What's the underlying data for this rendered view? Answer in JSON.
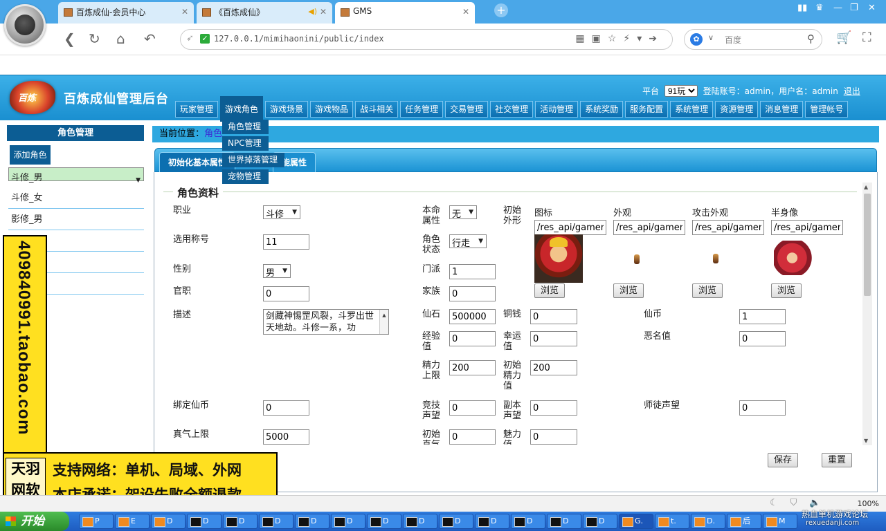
{
  "browser": {
    "tabs": [
      {
        "label": "百炼成仙-会员中心",
        "close": "✕"
      },
      {
        "label": "《百炼成仙》",
        "close": "✕"
      },
      {
        "label": "GMS",
        "close": "✕"
      }
    ],
    "url": "127.0.0.1/mimihaonini/public/index",
    "search_engine": "百度",
    "new_tab": "+",
    "audio_icon": "speaker-icon"
  },
  "app": {
    "title": "百炼成仙管理后台",
    "logo_text": "百炼",
    "platform_label": "平台",
    "platform_value": "91玩",
    "login_text": "登陆账号：admin，用户名：admin",
    "logout": "退出",
    "menu": [
      "玩家管理",
      "游戏角色",
      "游戏场景",
      "游戏物品",
      "战斗相关",
      "任务管理",
      "交易管理",
      "社交管理",
      "活动管理",
      "系统奖励",
      "服务配置",
      "系统管理",
      "资源管理",
      "消息管理",
      "管理帐号"
    ],
    "dropdown": [
      "角色管理",
      "NPC管理",
      "世界掉落管理",
      "宠物管理"
    ]
  },
  "sidebar": {
    "header": "角色管理",
    "add_button": "添加角色",
    "items": [
      "斗修_男",
      "斗修_女",
      "影修_男"
    ]
  },
  "content": {
    "crumb_label": "当前位置：",
    "crumb_link": "角色",
    "tabs": [
      "初始化基本属性",
      "能属性"
    ],
    "section_title": "角色资料",
    "fields": {
      "job": {
        "label": "职业",
        "value": "斗修"
      },
      "title": {
        "label": "选用称号",
        "value": "11"
      },
      "gender": {
        "label": "性别",
        "value": "男"
      },
      "office": {
        "label": "官职",
        "value": "0"
      },
      "desc": {
        "label": "描述",
        "value": "剑藏神惕罡风裂，斗罗出世天地劫。斗修一系，功"
      },
      "life_attr": {
        "label": "本命属性",
        "value": "无"
      },
      "state": {
        "label": "角色状态",
        "value": "行走"
      },
      "sect": {
        "label": "门派",
        "value": "1"
      },
      "family": {
        "label": "家族",
        "value": "0"
      },
      "init_look": {
        "label": "初始外形"
      },
      "xianshi": {
        "label": "仙石",
        "value": "500000"
      },
      "exp": {
        "label": "经验值",
        "value": "0"
      },
      "energy_max": {
        "label": "精力上限",
        "value": "200"
      },
      "arena_rep": {
        "label": "竞技声望",
        "value": "0"
      },
      "init_zhen": {
        "label": "初始真气",
        "value": "0"
      },
      "copper": {
        "label": "铜钱",
        "value": "0"
      },
      "luck": {
        "label": "幸运值",
        "value": "0"
      },
      "init_energy": {
        "label": "初始精力值",
        "value": "200"
      },
      "dungeon_rep": {
        "label": "副本声望",
        "value": "0"
      },
      "charm": {
        "label": "魅力值",
        "value": "0"
      },
      "xianbi": {
        "label": "仙币",
        "value": "1"
      },
      "infamy": {
        "label": "恶名值",
        "value": "0"
      },
      "master_rep": {
        "label": "师徒声望",
        "value": "0"
      },
      "bound_xianbi": {
        "label": "绑定仙币",
        "value": "0"
      },
      "zhenqi_max": {
        "label": "真气上限",
        "value": "5000"
      }
    },
    "images": [
      {
        "label": "图标",
        "path": "/res_api/gamere"
      },
      {
        "label": "外观",
        "path": "/res_api/gamere"
      },
      {
        "label": "攻击外观",
        "path": "/res_api/gamere"
      },
      {
        "label": "半身像",
        "path": "/res_api/gamere"
      }
    ],
    "browse": "浏览",
    "save": "保存",
    "reset": "重置"
  },
  "promo": {
    "vertical": "409840991.taobao.com",
    "brand": "天羽网软",
    "line1": "支持网络：单机、局域、外网",
    "line2": "本店承诺：架设失败全额退款"
  },
  "statusbar": {
    "zoom": "100%"
  },
  "taskbar": {
    "start": "开始",
    "items": [
      "P",
      "E",
      "D",
      "D",
      "D",
      "D",
      "D",
      "D",
      "D",
      "D",
      "D",
      "D",
      "D",
      "D",
      "G.",
      "t.",
      "D.",
      "后",
      "M"
    ],
    "tray": "热血单机游戏论坛",
    "tray_url": "rexuedanji.com"
  },
  "colors": {
    "accent": "#1a8fd0",
    "dark": "#0c5d94",
    "promo": "#ffe020"
  }
}
